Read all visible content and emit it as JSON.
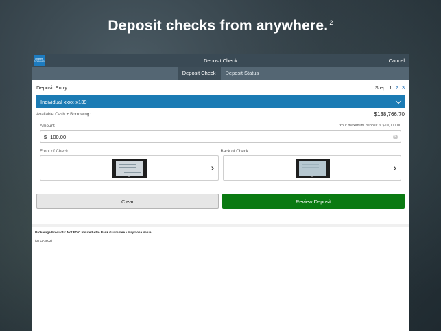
{
  "headline": {
    "text": "Deposit checks from anywhere.",
    "sup": "2"
  },
  "topbar": {
    "logo_text": "charles SCHWAB",
    "title": "Deposit Check",
    "cancel": "Cancel"
  },
  "tabs": [
    {
      "label": "Deposit Check"
    },
    {
      "label": "Deposit Status"
    }
  ],
  "entry": {
    "title": "Deposit Entry",
    "step_label": "Step",
    "steps": [
      "1",
      "2",
      "3"
    ]
  },
  "account": {
    "selected": "Individual xxxx-x139"
  },
  "available": {
    "label": "Available Cash + Borrowing:",
    "value": "$138,766.70"
  },
  "amount": {
    "label": "Amount",
    "max_note": "Your maximum deposit is $10,000.00",
    "currency": "$",
    "value": "100.00"
  },
  "checks": {
    "front_label": "Front of Check",
    "back_label": "Back of Check"
  },
  "buttons": {
    "clear": "Clear",
    "review": "Review Deposit"
  },
  "footer": {
    "disclaimer": "Brokerage Products: Not FDIC Insured • No Bank Guarantee • May Lose Value",
    "code": "(0712-3802)"
  },
  "colors": {
    "topbar": "#3a4a55",
    "tabbar": "#546673",
    "account_blue": "#1b7bb4",
    "review_green": "#0a7a12"
  }
}
